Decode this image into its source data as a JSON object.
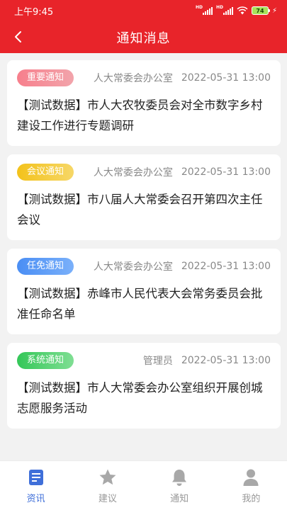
{
  "status_bar": {
    "time": "上午9:45",
    "battery": "74"
  },
  "header": {
    "title": "通知消息"
  },
  "notices": [
    {
      "tag": "重要通知",
      "source": "人大常委会办公室",
      "date": "2022-05-31 13:00",
      "title": "【测试数据】市人大农牧委员会对全市数字乡村建设工作进行专题调研"
    },
    {
      "tag": "会议通知",
      "source": "人大常委会办公室",
      "date": "2022-05-31 13:00",
      "title": "【测试数据】市八届人大常委会召开第四次主任会议"
    },
    {
      "tag": "任免通知",
      "source": "人大常委会办公室",
      "date": "2022-05-31 13:00",
      "title": "【测试数据】赤峰市人民代表大会常务委员会批准任命名单"
    },
    {
      "tag": "系统通知",
      "source": "管理员",
      "date": "2022-05-31 13:00",
      "title": "【测试数据】市人大常委会办公室组织开展创城志愿服务活动"
    }
  ],
  "tabs": [
    {
      "label": "资讯",
      "icon": "document-icon"
    },
    {
      "label": "建议",
      "icon": "star-icon"
    },
    {
      "label": "通知",
      "icon": "bell-icon"
    },
    {
      "label": "我的",
      "icon": "user-icon"
    }
  ],
  "colors": {
    "primary": "#e8242a",
    "active_tab": "#3f6fd9",
    "inactive_tab": "#999999"
  }
}
